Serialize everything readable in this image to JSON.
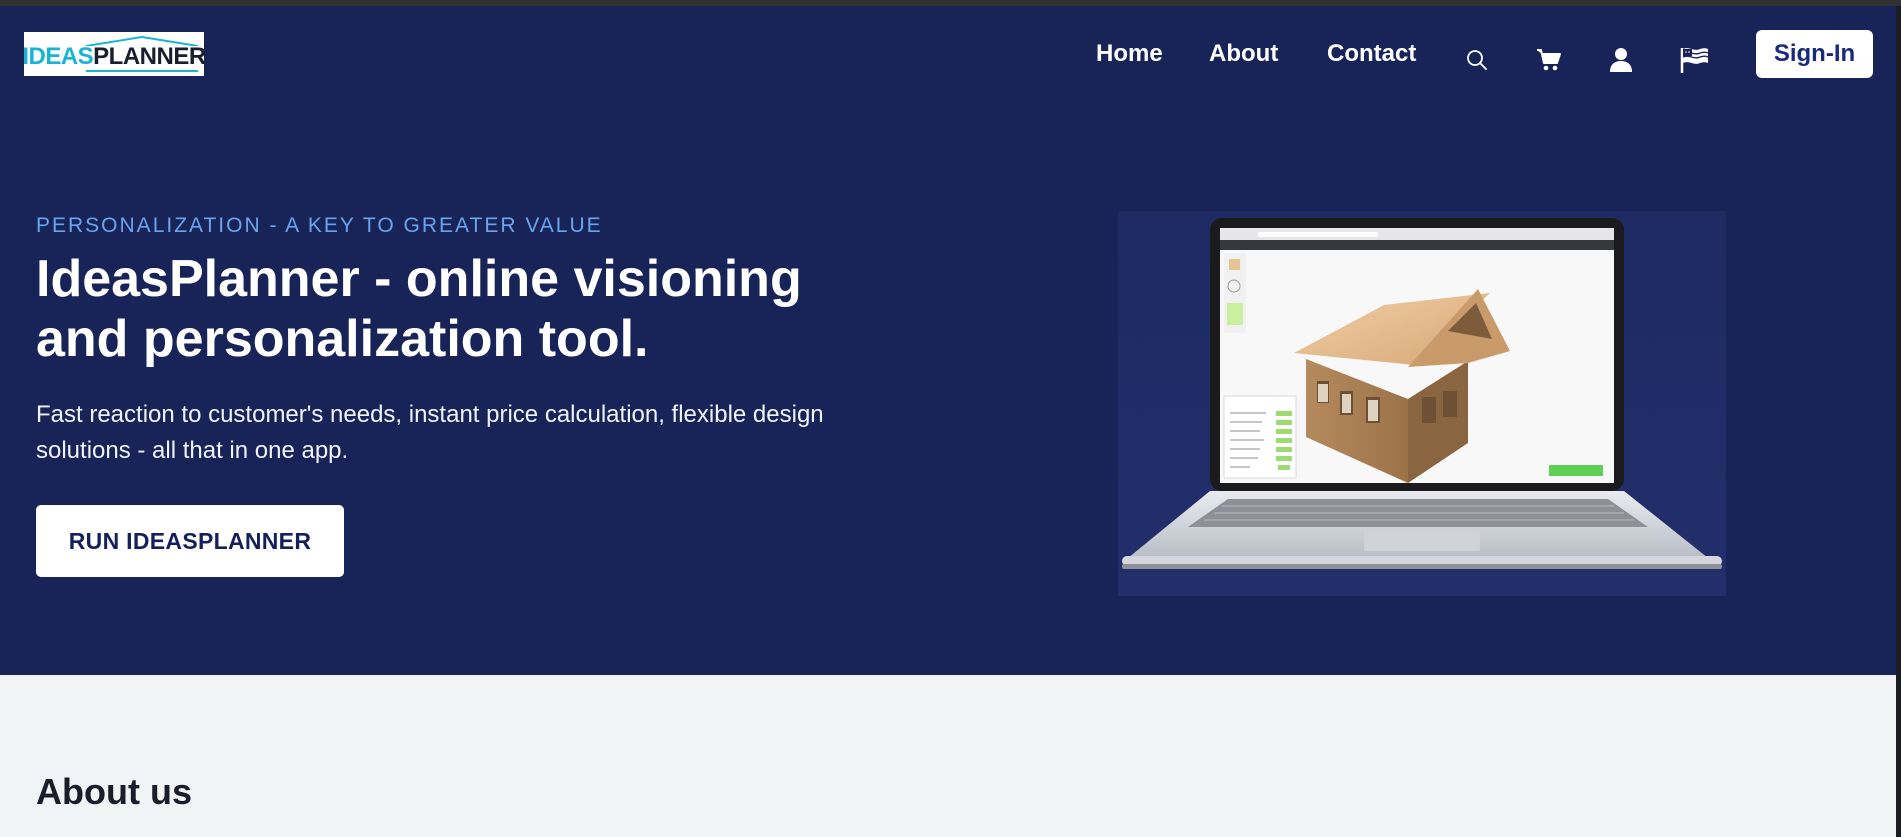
{
  "header": {
    "logo": {
      "part1": "IDEAS",
      "part2": "PLANNER"
    },
    "nav": [
      {
        "label": "Home"
      },
      {
        "label": "About"
      },
      {
        "label": "Contact"
      }
    ],
    "icons": [
      "search-icon",
      "cart-icon",
      "user-icon",
      "flag-icon"
    ],
    "signin_label": "Sign-In"
  },
  "hero": {
    "eyebrow": "PERSONALIZATION - A KEY TO GREATER VALUE",
    "headline": "IdeasPlanner - online visioning and personalization tool.",
    "subtext": "Fast reaction to customer's needs, instant price calculation, flexible design solutions - all that in one app.",
    "cta_label": "RUN IDEASPLANNER"
  },
  "about": {
    "title": "About us"
  },
  "colors": {
    "hero_bg": "#182458",
    "eyebrow": "#6aa3ee",
    "logo_accent": "#19b3d4",
    "signin_text": "#1a2a7a",
    "page_bg": "#f2f3f5"
  }
}
